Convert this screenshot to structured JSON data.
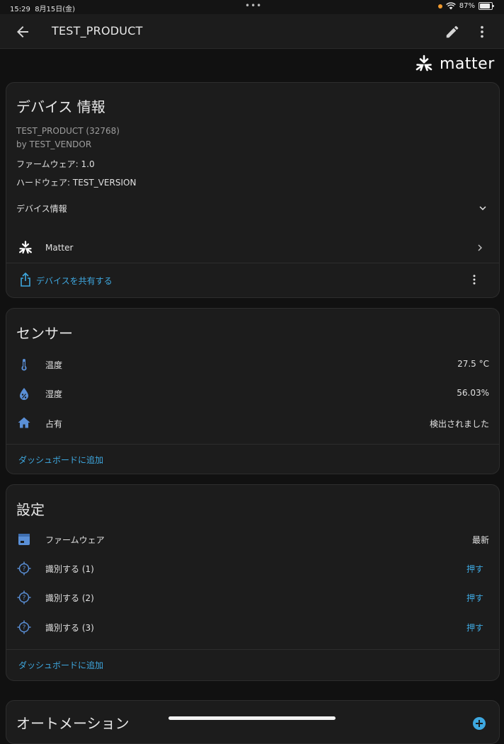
{
  "status": {
    "time": "15:29",
    "date": "8月15日(金)",
    "dots": "•••",
    "battery": "87%",
    "battery_level": 0.87
  },
  "appbar": {
    "title": "TEST_PRODUCT"
  },
  "brand": {
    "logo_text": "matter"
  },
  "device_info": {
    "title": "デバイス 情報",
    "product": "TEST_PRODUCT (32768)",
    "vendor": "by TEST_VENDOR",
    "firmware": "ファームウェア: 1.0",
    "hardware": "ハードウェア: TEST_VERSION",
    "expand_label": "デバイス情報",
    "integration_label": "Matter",
    "share_label": "デバイスを共有する"
  },
  "sensors": {
    "title": "センサー",
    "rows": [
      {
        "icon": "thermometer-icon",
        "label": "温度",
        "value": "27.5 °C"
      },
      {
        "icon": "humidity-icon",
        "label": "湿度",
        "value": "56.03%"
      },
      {
        "icon": "home-icon",
        "label": "占有",
        "value": "検出されました"
      }
    ],
    "add_label": "ダッシュボードに追加"
  },
  "settings": {
    "title": "設定",
    "firmware": {
      "icon": "firmware-icon",
      "label": "ファームウェア",
      "value": "最新"
    },
    "identify": [
      {
        "icon": "identify-icon",
        "label": "識別する (1)",
        "action": "押す"
      },
      {
        "icon": "identify-icon",
        "label": "識別する (2)",
        "action": "押す"
      },
      {
        "icon": "identify-icon",
        "label": "識別する (3)",
        "action": "押す"
      }
    ],
    "add_label": "ダッシュボードに追加"
  },
  "automation": {
    "title": "オートメーション"
  },
  "colors": {
    "accent": "#3ea8e0",
    "icon_blue": "#5a8fd6",
    "background": "#111111",
    "card": "#1c1c1c"
  }
}
